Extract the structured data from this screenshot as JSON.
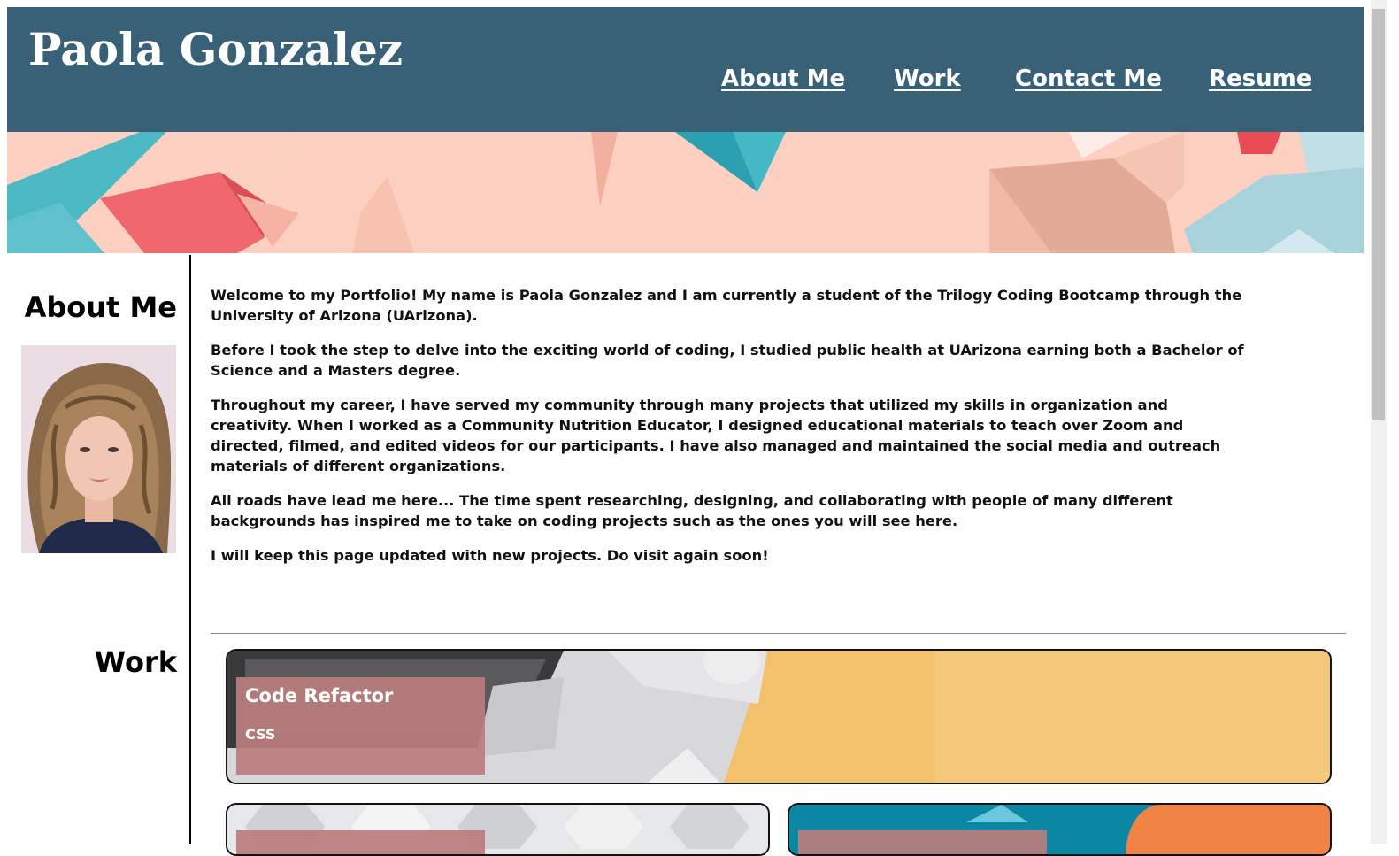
{
  "header": {
    "title": "Paola Gonzalez",
    "nav": [
      "About Me",
      "Work",
      "Contact Me",
      "Resume"
    ]
  },
  "about": {
    "heading": "About Me",
    "paragraphs": [
      "Welcome to my Portfolio! My name is Paola Gonzalez and I am currently a student of the Trilogy Coding Bootcamp through the University of Arizona (UArizona).",
      "Before I took the step to delve into the exciting world of coding, I studied public health at UArizona earning both a Bachelor of Science and a Masters degree.",
      "Throughout my career, I have served my community through many projects that utilized my skills in organization and creativity. When I worked as a Community Nutrition Educator, I designed educational materials to teach over Zoom and directed, filmed, and edited videos for our participants. I have also managed and maintained the social media and outreach materials of different organizations.",
      "All roads have lead me here... The time spent researching, designing, and collaborating with people of many different backgrounds has inspired me to take on coding projects such as the ones you will see here.",
      "I will keep this page updated with new projects. Do visit again soon!"
    ]
  },
  "work": {
    "heading": "Work",
    "projects": [
      {
        "title": "Code Refactor",
        "subtitle": "CSS"
      }
    ]
  },
  "colors": {
    "header_bg": "#386077",
    "card_caption_bg": "#b97d7d",
    "hero_bg": "#fdd0c2"
  }
}
